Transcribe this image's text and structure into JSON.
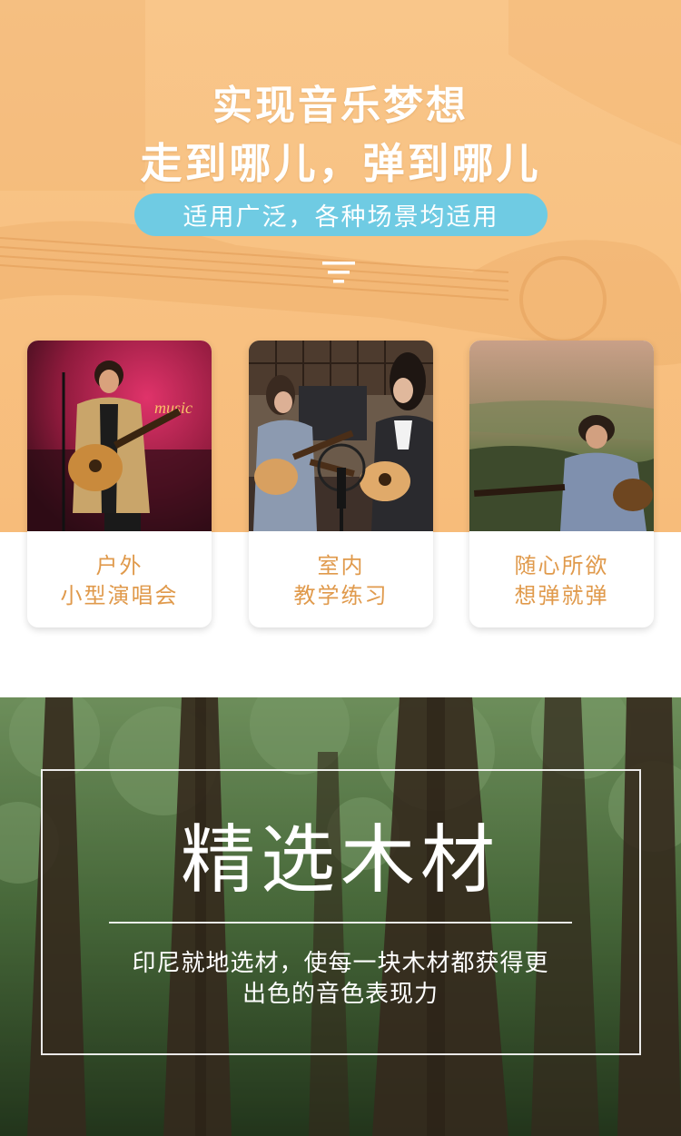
{
  "hero": {
    "title_line1": "实现音乐梦想",
    "title_line2": "走到哪儿，弹到哪儿",
    "subtitle": "适用广泛，各种场景均适用",
    "accent_color": "#6fcbe3",
    "background_color": "#f9c68a",
    "menu_icon": "menu-lines-icon"
  },
  "scenes": [
    {
      "caption_line1": "户外",
      "caption_line2": "小型演唱会",
      "photo": "outdoor-concert-photo"
    },
    {
      "caption_line1": "室内",
      "caption_line2": "教学练习",
      "photo": "indoor-practice-photo"
    },
    {
      "caption_line1": "随心所欲",
      "caption_line2": "想弹就弹",
      "photo": "hillside-guitar-photo"
    }
  ],
  "caption_color": "#e09a4c",
  "wood": {
    "title": "精选木材",
    "description_line1": "印尼就地选材，使每一块木材都获得更",
    "description_line2": "出色的音色表现力",
    "background": "forest-photo"
  }
}
